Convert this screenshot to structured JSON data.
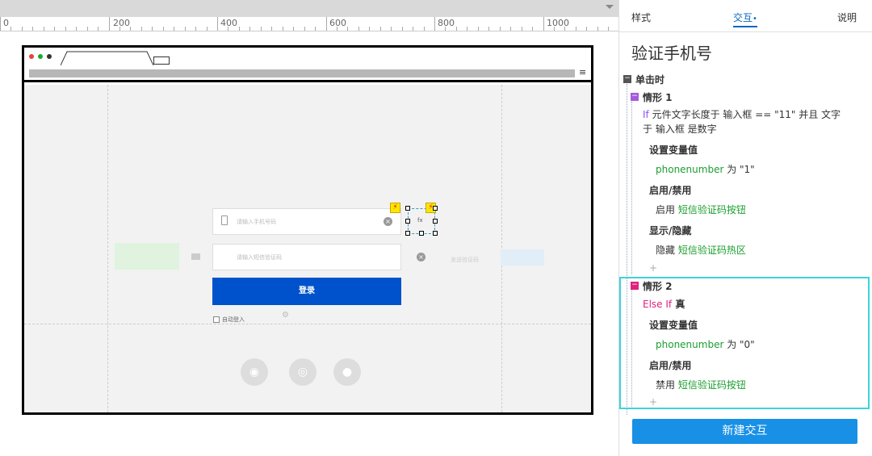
{
  "ruler": {
    "labels": [
      "0",
      "200",
      "400",
      "600",
      "800",
      "1000"
    ]
  },
  "mock": {
    "phone_placeholder": "请输入手机号码",
    "code_placeholder": "请输入短信验证码",
    "send_code": "发送验证码",
    "login": "登录",
    "auto_login": "自动登入",
    "fx": "fx",
    "colors": {
      "login_button": "#0052cc",
      "page_bg": "#f2f2f2"
    }
  },
  "panel": {
    "tabs": {
      "style": "样式",
      "interaction": "交互",
      "interaction_dot": "•",
      "notes": "说明"
    },
    "title": "验证手机号",
    "event": "单击时",
    "case1": {
      "name": "情形 1",
      "cond_kw": "If",
      "cond_line1": " 元件文字长度于 输入框 == \"11\" 并且 文字",
      "cond_line2": "于 输入框 是数字",
      "a1_title": "设置变量值",
      "a1_var": "phonenumber",
      "a1_rest": " 为 \"1\"",
      "a2_title": "启用/禁用",
      "a2_verb": "启用 ",
      "a2_target": "短信验证码按钮",
      "a3_title": "显示/隐藏",
      "a3_verb": "隐藏 ",
      "a3_target": "短信验证码热区"
    },
    "case2": {
      "name": "情形 2",
      "cond_kw": "Else If",
      "cond_rest": " 真",
      "a1_title": "设置变量值",
      "a1_var": "phonenumber",
      "a1_rest": " 为 \"0\"",
      "a2_title": "启用/禁用",
      "a2_verb": "禁用 ",
      "a2_target": "短信验证码按钮"
    },
    "plus": "+",
    "new_button": "新建交互",
    "colors": {
      "accent": "#0a66c2",
      "highlight": "#3bd4db",
      "action_green": "#1a9e2f",
      "button_blue": "#1890e6"
    }
  }
}
